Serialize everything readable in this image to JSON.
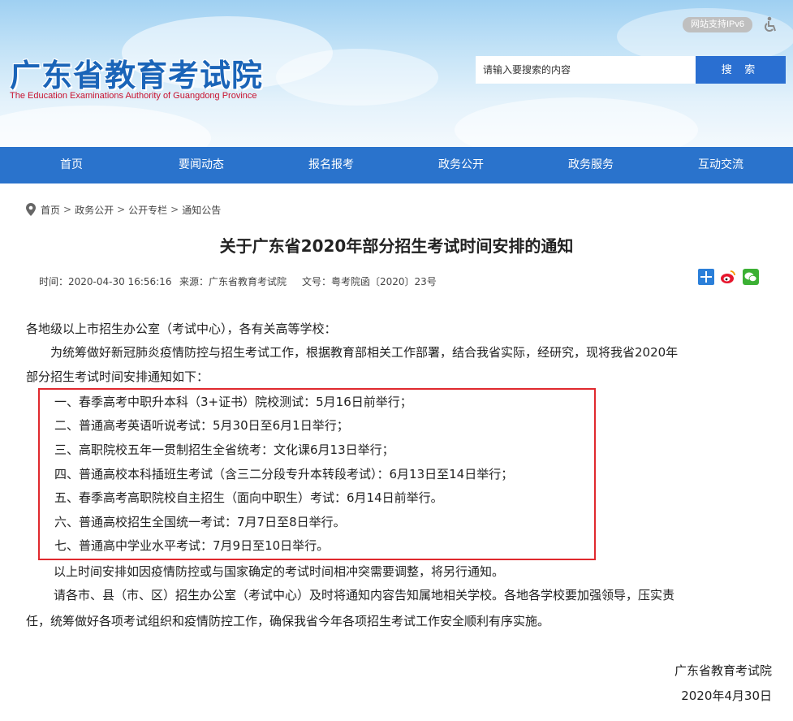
{
  "header": {
    "logo_cn": "广东省教育考试院",
    "logo_en": "The Education Examinations Authority of Guangdong Province",
    "ipv6_badge": "网站支持IPv6",
    "search": {
      "placeholder": "请输入要搜索的内容",
      "button_label": "搜 索"
    }
  },
  "nav": {
    "items": [
      "首页",
      "要闻动态",
      "报名报考",
      "政务公开",
      "政务服务",
      "互动交流"
    ]
  },
  "breadcrumb": [
    "首页",
    "政务公开",
    "公开专栏",
    "通知公告"
  ],
  "article": {
    "title": "关于广东省2020年部分招生考试时间安排的通知",
    "meta": {
      "time": "时间：2020-04-30 16:56:16",
      "source": "来源：广东省教育考试院",
      "doc_no": "文号：粤考院函〔2020〕23号"
    },
    "salutation": "各地级以上市招生办公室（考试中心），各有关高等学校：",
    "intro_line1": "为统筹做好新冠肺炎疫情防控与招生考试工作，根据教育部相关工作部署，结合我省实际，经研究，现将我省2020年",
    "intro_line2": "部分招生考试时间安排通知如下：",
    "items": [
      "一、春季高考中职升本科（3+证书）院校测试：5月16日前举行；",
      "二、普通高考英语听说考试：5月30日至6月1日举行；",
      "三、高职院校五年一贯制招生全省统考：文化课6月13日举行；",
      "四、普通高校本科插班生考试（含三二分段专升本转段考试）：6月13日至14日举行；",
      "五、春季高考高职院校自主招生（面向中职生）考试：6月14日前举行。",
      "六、普通高校招生全国统一考试：7月7日至8日举行。",
      "七、普通高中学业水平考试：7月9日至10日举行。"
    ],
    "note": "以上时间安排如因疫情防控或与国家确定的考试时间相冲突需要调整，将另行通知。",
    "closing_line1": "请各市、县（市、区）招生办公室（考试中心）及时将通知内容告知属地相关学校。各地各学校要加强领导，压实责",
    "closing_line2": "任，统筹做好各项考试组织和疫情防控工作，确保我省今年各项招生考试工作安全顺利有序实施。",
    "signature": "广东省教育考试院",
    "date": "2020年4月30日"
  },
  "colors": {
    "nav_bg": "#2a73cc",
    "search_btn": "#2a6fd1",
    "highlight_border": "#e0292e",
    "logo_blue": "#1a64b8"
  },
  "icons": [
    "wheelchair-accessibility-icon",
    "location-pin-icon",
    "share-plus-icon",
    "weibo-icon",
    "wechat-icon"
  ]
}
